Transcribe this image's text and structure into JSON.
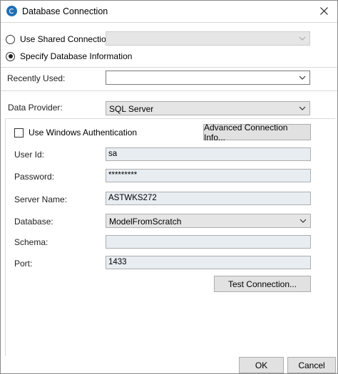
{
  "window": {
    "title": "Database Connection"
  },
  "connection_mode": {
    "shared_label": "Use Shared Connection",
    "specify_label": "Specify Database Information",
    "selected": "specify"
  },
  "recently_used": {
    "label": "Recently Used:",
    "value": ""
  },
  "data_provider": {
    "label": "Data Provider:",
    "value": "SQL Server"
  },
  "auth": {
    "windows_auth_label": "Use Windows Authentication",
    "windows_auth_checked": false,
    "advanced_button_label": "Advanced Connection Info..."
  },
  "fields": {
    "user_id": {
      "label": "User Id:",
      "value": "sa"
    },
    "password": {
      "label": "Password:",
      "value": "*********"
    },
    "server_name": {
      "label": "Server Name:",
      "value": "ASTWKS272"
    },
    "database": {
      "label": "Database:",
      "value": "ModelFromScratch"
    },
    "schema": {
      "label": "Schema:",
      "value": ""
    },
    "port": {
      "label": "Port:",
      "value": "1433"
    }
  },
  "buttons": {
    "test_connection": "Test Connection...",
    "ok": "OK",
    "cancel": "Cancel"
  },
  "icons": {
    "app": "app-logo-icon",
    "close": "close-icon",
    "chevron": "chevron-down-icon"
  }
}
